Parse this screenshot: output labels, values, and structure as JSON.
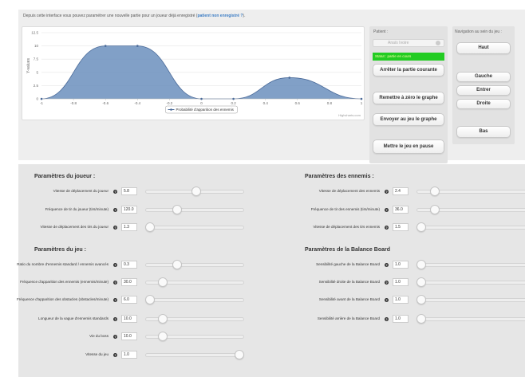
{
  "top_info": {
    "text": "Depuis cette interface vous pouvez paramétrer une nouvelle partie pour un joueur déjà enregistré (",
    "link": "patient non enregistré ?",
    "suffix": ")."
  },
  "chart_data": {
    "type": "area",
    "x": [
      -1,
      -0.8,
      -0.6,
      -0.4,
      -0.2,
      0,
      0.2,
      0.4,
      0.6,
      0.8,
      1
    ],
    "series": [
      {
        "name": "Probabilité d'apparition des ennemis",
        "points": [
          [
            -1,
            0
          ],
          [
            -0.6,
            10
          ],
          [
            -0.4,
            10
          ],
          [
            0,
            0
          ],
          [
            0.2,
            0
          ],
          [
            0.55,
            4
          ],
          [
            1,
            0
          ]
        ]
      }
    ],
    "xlim": [
      -1,
      1
    ],
    "ylim": [
      0,
      12.5
    ],
    "yticks": [
      "0",
      "2.5",
      "5",
      "7.5",
      "10",
      "12.5"
    ],
    "xticks": [
      "-1",
      "-0.8",
      "-0.6",
      "-0.4",
      "-0.2",
      "0",
      "0.2",
      "0.4",
      "0.6",
      "0.8",
      "1"
    ],
    "ylabel": "Y-values",
    "credits": "Highcharts.com",
    "color": "#6b8fbd"
  },
  "patient": {
    "title": "Patient :",
    "name": "Anaïs Ivoire",
    "status": "Statut : partie en cours",
    "stop_btn": "Arrêter la partie courante",
    "reset_btn": "Remettre à zéro le graphe",
    "send_btn": "Envoyer au jeu le graphe",
    "pause_btn": "Mettre le jeu en pause"
  },
  "nav": {
    "title": "Navigation au sein du jeu :",
    "up": "Haut",
    "left": "Gauche",
    "enter": "Entrer",
    "right": "Droite",
    "down": "Bas"
  },
  "player_params": {
    "title": "Paramètres du joueur :",
    "rows": [
      {
        "label": "Vitesse de déplacement du joueur",
        "value": "5.8",
        "fraction": 0.52
      },
      {
        "label": "Fréquence de tir du joueur (tirs/minute)",
        "value": "120.0",
        "fraction": 0.3
      },
      {
        "label": "Vitesse de déplacement des tirs du joueur",
        "value": "1.3",
        "fraction": 0.0
      }
    ]
  },
  "enemy_params": {
    "title": "Paramètres des ennemis :",
    "rows": [
      {
        "label": "Vitesse de déplacement des ennemis",
        "value": "2.4",
        "fraction": 0.12
      },
      {
        "label": "Fréquence de tir des ennemis (tirs/minute)",
        "value": "36.0",
        "fraction": 0.12
      },
      {
        "label": "Vitesse de déplacement des tirs ennemis",
        "value": "1.5",
        "fraction": 0.0
      }
    ]
  },
  "game_params": {
    "title": "Paramètres du jeu :",
    "rows": [
      {
        "label": "Ratio du nombre d'ennemis standard / ennemis avancés",
        "value": "0.3",
        "fraction": 0.3
      },
      {
        "label": "Fréquence d'apparition des ennemis (ennemis/minute)",
        "value": "30.0",
        "fraction": 0.14
      },
      {
        "label": "Fréquence d'apparition des obstacles (obstacles/minute)",
        "value": "6.0",
        "fraction": 0.0
      },
      {
        "label": "Longueur de la vague d'ennemis standards",
        "value": "10.0",
        "fraction": 0.14
      },
      {
        "label": "Vie du boss",
        "value": "10.0",
        "fraction": 0.14
      },
      {
        "label": "Vitesse du jeu",
        "value": "1.0",
        "fraction": 1.0
      }
    ]
  },
  "balance_params": {
    "title": "Paramètres de la Balance Board",
    "rows": [
      {
        "label": "Sensibilité gauche de la Balance Board",
        "value": "1.0",
        "fraction": 0.0
      },
      {
        "label": "Sensibilité droite de la Balance Board",
        "value": "1.0",
        "fraction": 0.0
      },
      {
        "label": "Sensibilité avant de la Balance Board",
        "value": "1.0",
        "fraction": 0.0
      },
      {
        "label": "Sensibilité arrière de la Balance Board",
        "value": "1.0",
        "fraction": 0.0
      }
    ]
  }
}
